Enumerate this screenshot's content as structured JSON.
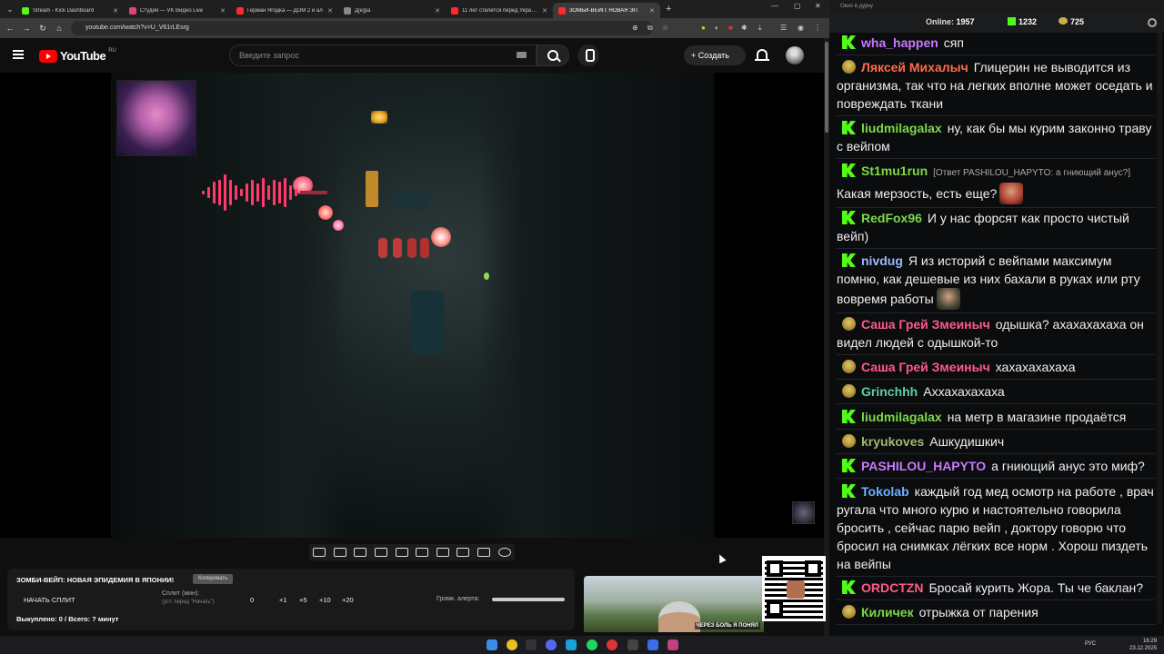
{
  "browser": {
    "tabs": [
      {
        "title": "Stream - Kick Dashboard",
        "color": "#53fc18"
      },
      {
        "title": "Студия — VK Видео Live",
        "color": "#e0437a"
      },
      {
        "title": "Герман Ягодка — ДОМ 2 и ал",
        "color": "#ff2a2a"
      },
      {
        "title": "Д[е]ра",
        "color": "#888888"
      },
      {
        "title": "11 лет стелется перед Украине",
        "color": "#ff2a2a"
      },
      {
        "title": "ЗОМБИ-ВЕЙП: НОВАЯ ЭП",
        "color": "#ff2a2a",
        "active": true
      }
    ],
    "url": "youtube.com/watch?v=U_V61rLEsrg"
  },
  "youtube": {
    "logo_text": "YouTube",
    "logo_region": "RU",
    "search_placeholder": "Введите запрос",
    "create_label": "Создать"
  },
  "split_panel": {
    "title": "ЗОМБИ-ВЕЙП: НОВАЯ ЭПИДЕМИЯ В ЯПОНИИ!",
    "copy_label": "Копировать",
    "start_split": "НАЧАТЬ СПЛИТ",
    "split_min_label": "Сплит (мин):",
    "split_hint": "(уст. перед \"Начать\")",
    "buttons": [
      "0",
      "+1",
      "+5",
      "+10",
      "+20"
    ],
    "alert_volume_label": "Громк. алерта:",
    "smoked_status": "Выкуплено: 0 / Всего: ? минут"
  },
  "yt_card": {
    "caption": "ЧЕРЕЗ БОЛЬ Я ПОНЯЛ"
  },
  "chat": {
    "window_title": "Окно в дурку",
    "online_label": "Online:",
    "online_count": "1957",
    "kick_count": "1232",
    "yt_count": "725",
    "messages": [
      {
        "platform": "kick",
        "nick": "wha_happen",
        "color": "#c978ff",
        "text": "сяп"
      },
      {
        "platform": "yt",
        "nick": "Ляксей Михалыч",
        "color": "#ff6b4a",
        "text": "Глицерин не выводится из организма, так что на легких вполне может оседать и повреждать ткани"
      },
      {
        "platform": "kick",
        "nick": "liudmilagalax",
        "color": "#7dd84a",
        "text": "ну, как бы мы курим законно траву с вейпом"
      },
      {
        "platform": "kick",
        "nick": "St1mu1run",
        "color": "#7dd84a",
        "reply": "[Ответ PASHILOU_HAPYTO: а гниющий анус?]",
        "text": "Какая мерзость, есть еще?"
      },
      {
        "platform": "kick",
        "nick": "RedFox96",
        "color": "#7dd84a",
        "text": "И у нас форсят как просто чистый вейп)"
      },
      {
        "platform": "kick",
        "nick": "nivdug",
        "color": "#9cb8ff",
        "text": "Я из историй с вейпами максимум помню, как дешевые из них бахали в руках или рту вовремя работы"
      },
      {
        "platform": "yt",
        "nick": "Саша Грей Змеиныч",
        "color": "#ff5a8a",
        "text": "одышка? ахахахахаха он видел людей с одышкой-то"
      },
      {
        "platform": "yt",
        "nick": "Саша Грей Змеиныч",
        "color": "#ff5a8a",
        "text": "хахахахахаха"
      },
      {
        "platform": "yt",
        "nick": "Grinchhh",
        "color": "#5ed0a0",
        "text": "Аххахахахаха"
      },
      {
        "platform": "kick",
        "nick": "liudmilagalax",
        "color": "#7dd84a",
        "text": "на метр в магазине продаётся"
      },
      {
        "platform": "yt",
        "nick": "kryukoves",
        "color": "#a0b870",
        "text": "Ашкудишкич"
      },
      {
        "platform": "kick",
        "nick": "PASHILOU_HAPYTO",
        "color": "#c978ff",
        "text": "а гниющий анус это миф?"
      },
      {
        "platform": "kick",
        "nick": "Tokolab",
        "color": "#6fb0ff",
        "text": "каждый год мед осмотр на работе , врач ругала что много курю и настоятельно говорила бросить , сейчас парю вейп , доктору говорю что бросил на снимках лёгких все норм . Хорош пиздеть на вейпы"
      },
      {
        "platform": "kick",
        "nick": "ORDCTZN",
        "color": "#ff5a8a",
        "text": "Бросай курить Жора. Ты че баклан?"
      },
      {
        "platform": "yt",
        "nick": "Киличек",
        "color": "#7dd84a",
        "text": "отрыжка от парения"
      }
    ]
  },
  "taskbar": {
    "lang": "РУС",
    "time": "16:29",
    "date": "23.12.2025"
  }
}
